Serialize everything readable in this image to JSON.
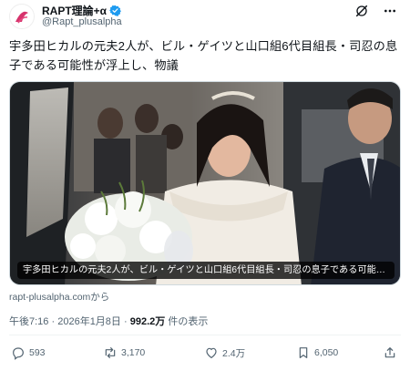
{
  "author": {
    "display_name": "RAPT理論+α",
    "handle": "@Rapt_plusalpha",
    "verified": true,
    "avatar_icon": "rapt-logo-icon"
  },
  "header_icons": [
    "grok-icon",
    "more-icon"
  ],
  "tweet": {
    "text": "宇多田ヒカルの元夫2人が、ビル・ゲイツと山口組6代目組長・司忍の息子である可能性が浮上し、物議"
  },
  "media": {
    "caption": "宇多田ヒカルの元夫2人が、ビル・ゲイツと山口組6代目組長・司忍の息子である可能性..."
  },
  "link_source": "rapt-plusalpha.comから",
  "meta": {
    "time": "午後7:16",
    "separator": "·",
    "date": "2026年1月8日",
    "views_count": "992.2万",
    "views_label": "件の表示"
  },
  "actions": {
    "replies": "593",
    "reposts": "3,170",
    "likes": "2.4万",
    "bookmarks": "6,050"
  },
  "colors": {
    "text": "#0f1419",
    "secondary": "#536471",
    "verified": "#1d9bf0",
    "divider": "#eff3f4"
  }
}
